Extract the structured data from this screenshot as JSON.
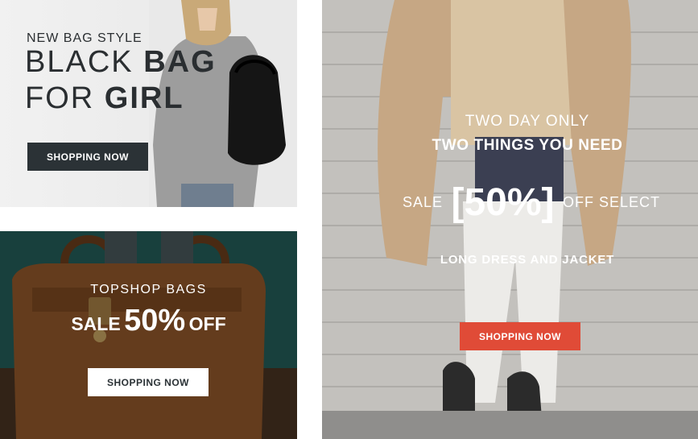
{
  "banner_bag": {
    "eyebrow": "NEW BAG STYLE",
    "line1_light": "BLACK",
    "line1_bold": "BAG",
    "line2_light": "FOR",
    "line2_bold": "GIRL",
    "button_label": "SHOPPING NOW"
  },
  "banner_topshop": {
    "eyebrow": "TOPSHOP BAGS",
    "sale_word": "SALE",
    "percent": "50%",
    "off_word": "OFF",
    "button_label": "SHOPPING NOW"
  },
  "banner_promo": {
    "eyebrow": "TWO DAY ONLY",
    "headline": "TWO THINGS YOU NEED",
    "sale_word": "SALE",
    "percent_display": "[50%]",
    "off_text": "OFF SELECT",
    "subline": "LONG DRESS AND JACKET",
    "button_label": "SHOPPING NOW"
  },
  "colors": {
    "dark_button": "#2b3236",
    "accent_button": "#e04b37",
    "light_button": "#ffffff",
    "text_dark": "#2a2e31"
  }
}
